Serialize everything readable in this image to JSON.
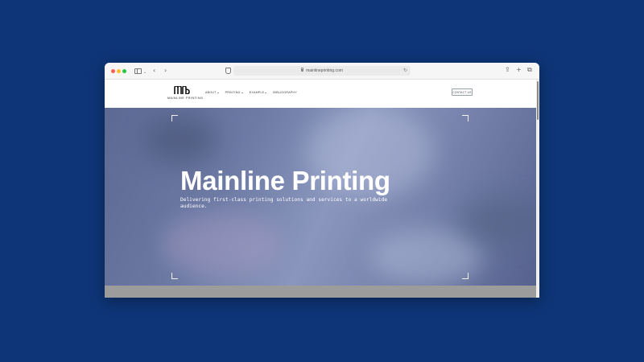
{
  "browser": {
    "url": "mainlineprinting.com",
    "icons": [
      "sidebar-icon",
      "chevron-left-icon",
      "chevron-right-icon",
      "shield-icon",
      "lock-icon",
      "reload-icon",
      "share-icon",
      "plus-icon",
      "tabs-icon"
    ]
  },
  "site": {
    "logo_text": "MAINLINE PRINTING",
    "nav": [
      {
        "label": "ABOUT"
      },
      {
        "label": "PRINTING"
      },
      {
        "label": "EXAMPLE"
      },
      {
        "label": "BIBLIOGRAPHY"
      }
    ],
    "contact_label": "CONTACT US"
  },
  "hero": {
    "title": "Mainline Printing",
    "subtitle": "Delivering first-class printing solutions and services to a worldwide audience."
  },
  "colors": {
    "background": "#0e3577",
    "hero_tint": "#6c7aa4",
    "text_on_hero": "#ffffff"
  }
}
